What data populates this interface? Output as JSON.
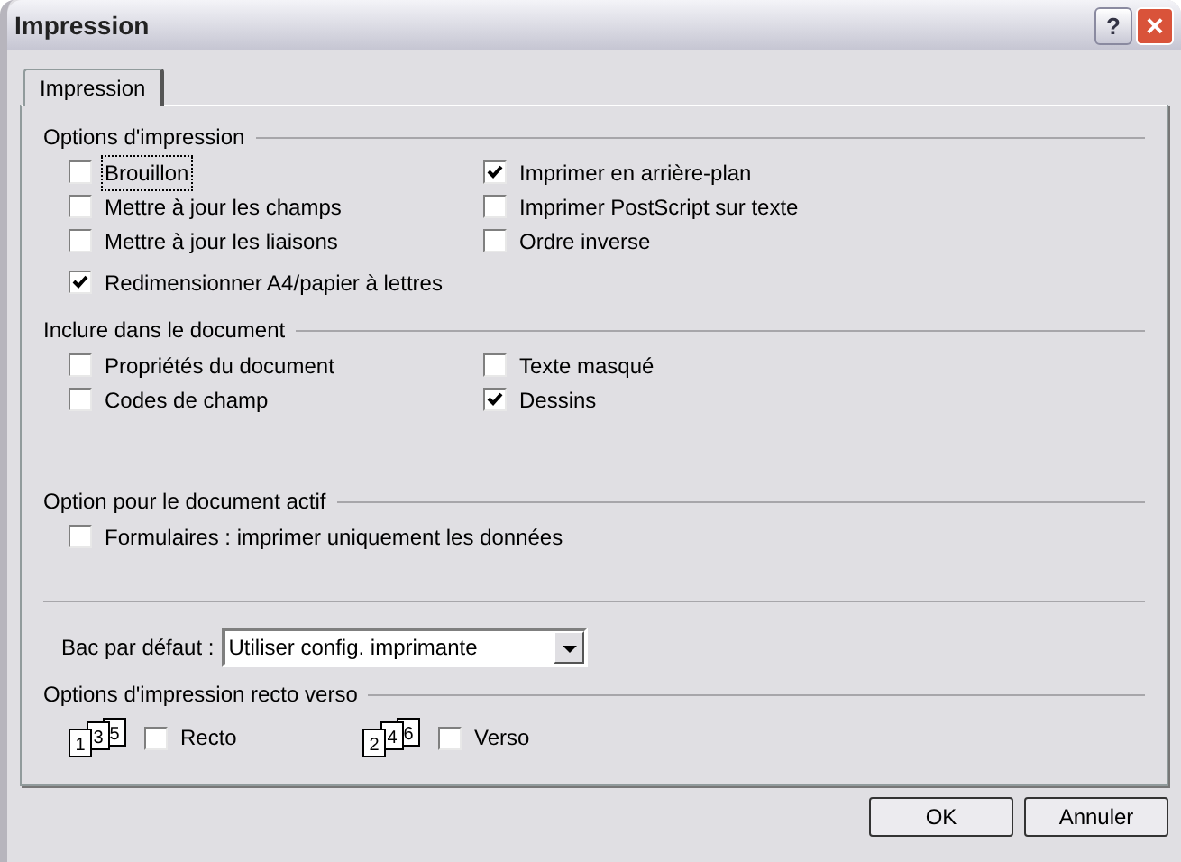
{
  "window": {
    "title": "Impression",
    "help_button": "?",
    "close_button": "×"
  },
  "tabs": [
    {
      "label": "Impression",
      "selected": true
    }
  ],
  "groups": [
    {
      "title": "Options d'impression",
      "columns": [
        [
          {
            "label": "Brouillon",
            "checked": false,
            "focused": true
          },
          {
            "label": "Mettre à jour les champs",
            "checked": false,
            "focused": false
          },
          {
            "label": "Mettre à jour les liaisons",
            "checked": false,
            "focused": false
          }
        ],
        [
          {
            "label": "Imprimer en arrière-plan",
            "checked": true,
            "focused": false
          },
          {
            "label": "Imprimer PostScript sur texte",
            "checked": false,
            "focused": false
          },
          {
            "label": "Ordre inverse",
            "checked": false,
            "focused": false
          }
        ]
      ],
      "extra": [
        {
          "label": "Redimensionner A4/papier à lettres",
          "checked": true,
          "focused": false
        }
      ]
    },
    {
      "title": "Inclure dans le document",
      "columns": [
        [
          {
            "label": "Propriétés du document",
            "checked": false,
            "focused": false
          },
          {
            "label": "Codes de champ",
            "checked": false,
            "focused": false
          }
        ],
        [
          {
            "label": "Texte masqué",
            "checked": false,
            "focused": false
          },
          {
            "label": "Dessins",
            "checked": true,
            "focused": false
          }
        ]
      ]
    },
    {
      "title": "Option pour le document actif",
      "columns": [
        [
          {
            "label": "Formulaires : imprimer uniquement les données",
            "checked": false,
            "focused": false
          }
        ]
      ]
    }
  ],
  "tray": {
    "label": "Bac par défaut :",
    "value": "Utiliser config. imprimante"
  },
  "duplex": {
    "title": "Options d'impression recto verso",
    "items": [
      {
        "pages": [
          "1",
          "3",
          "5"
        ],
        "label": "Recto",
        "checked": false
      },
      {
        "pages": [
          "2",
          "4",
          "6"
        ],
        "label": "Verso",
        "checked": false
      }
    ]
  },
  "buttons": [
    "OK",
    "Annuler"
  ]
}
